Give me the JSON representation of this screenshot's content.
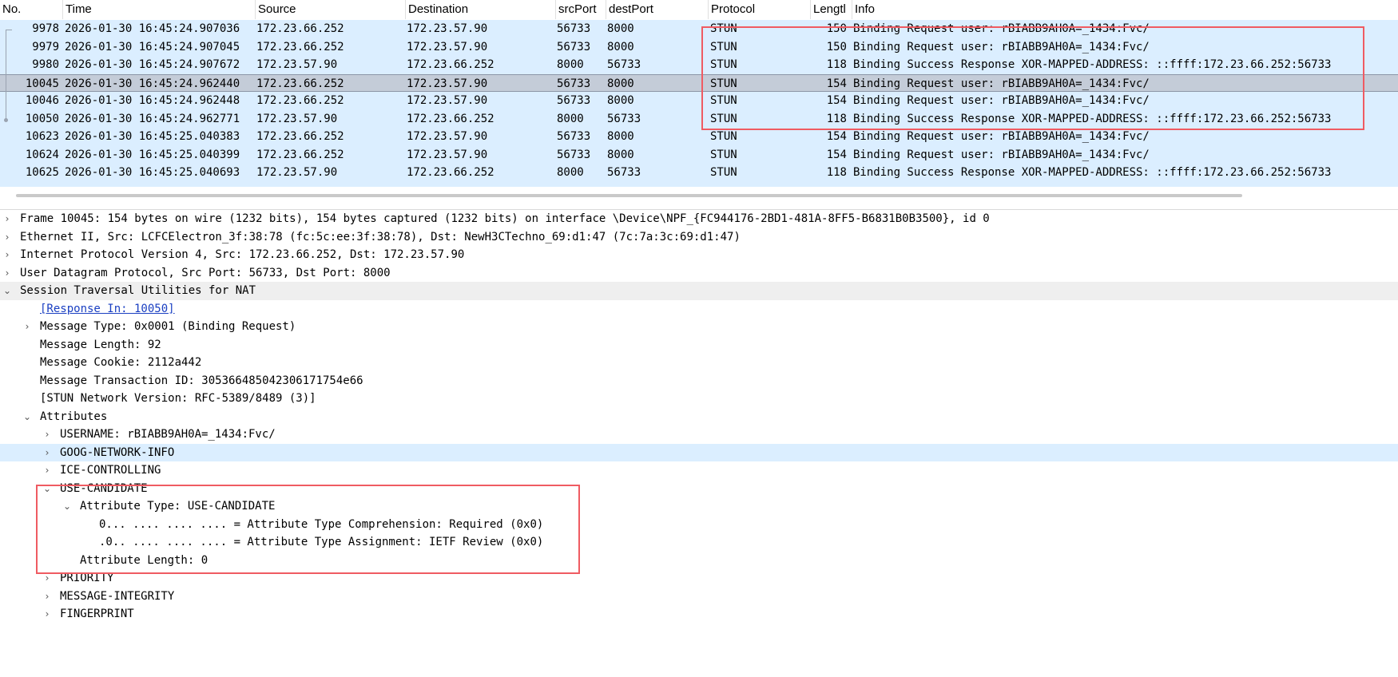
{
  "columns": [
    "No.",
    "Time",
    "Source",
    "Destination",
    "srcPort",
    "destPort",
    "Protocol",
    "Lengtl",
    "Info"
  ],
  "packets": [
    {
      "no": "9978",
      "time": "2026-01-30 16:45:24.907036",
      "src": "172.23.66.252",
      "dst": "172.23.57.90",
      "sport": "56733",
      "dport": "8000",
      "proto": "STUN",
      "len": "150",
      "info": "Binding Request user: rBIABB9AH0A=_1434:Fvc/"
    },
    {
      "no": "9979",
      "time": "2026-01-30 16:45:24.907045",
      "src": "172.23.66.252",
      "dst": "172.23.57.90",
      "sport": "56733",
      "dport": "8000",
      "proto": "STUN",
      "len": "150",
      "info": "Binding Request user: rBIABB9AH0A=_1434:Fvc/"
    },
    {
      "no": "9980",
      "time": "2026-01-30 16:45:24.907672",
      "src": "172.23.57.90",
      "dst": "172.23.66.252",
      "sport": "8000",
      "dport": "56733",
      "proto": "STUN",
      "len": "118",
      "info": "Binding Success Response XOR-MAPPED-ADDRESS: ::ffff:172.23.66.252:56733"
    },
    {
      "no": "10045",
      "time": "2026-01-30 16:45:24.962440",
      "src": "172.23.66.252",
      "dst": "172.23.57.90",
      "sport": "56733",
      "dport": "8000",
      "proto": "STUN",
      "len": "154",
      "info": "Binding Request user: rBIABB9AH0A=_1434:Fvc/"
    },
    {
      "no": "10046",
      "time": "2026-01-30 16:45:24.962448",
      "src": "172.23.66.252",
      "dst": "172.23.57.90",
      "sport": "56733",
      "dport": "8000",
      "proto": "STUN",
      "len": "154",
      "info": "Binding Request user: rBIABB9AH0A=_1434:Fvc/"
    },
    {
      "no": "10050",
      "time": "2026-01-30 16:45:24.962771",
      "src": "172.23.57.90",
      "dst": "172.23.66.252",
      "sport": "8000",
      "dport": "56733",
      "proto": "STUN",
      "len": "118",
      "info": "Binding Success Response XOR-MAPPED-ADDRESS: ::ffff:172.23.66.252:56733"
    },
    {
      "no": "10623",
      "time": "2026-01-30 16:45:25.040383",
      "src": "172.23.66.252",
      "dst": "172.23.57.90",
      "sport": "56733",
      "dport": "8000",
      "proto": "STUN",
      "len": "154",
      "info": "Binding Request user: rBIABB9AH0A=_1434:Fvc/"
    },
    {
      "no": "10624",
      "time": "2026-01-30 16:45:25.040399",
      "src": "172.23.66.252",
      "dst": "172.23.57.90",
      "sport": "56733",
      "dport": "8000",
      "proto": "STUN",
      "len": "154",
      "info": "Binding Request user: rBIABB9AH0A=_1434:Fvc/"
    },
    {
      "no": "10625",
      "time": "2026-01-30 16:45:25.040693",
      "src": "172.23.57.90",
      "dst": "172.23.66.252",
      "sport": "8000",
      "dport": "56733",
      "proto": "STUN",
      "len": "118",
      "info": "Binding Success Response XOR-MAPPED-ADDRESS: ::ffff:172.23.66.252:56733"
    }
  ],
  "details": {
    "frame": "Frame 10045: 154 bytes on wire (1232 bits), 154 bytes captured (1232 bits) on interface \\Device\\NPF_{FC944176-2BD1-481A-8FF5-B6831B0B3500}, id 0",
    "ethernet": "Ethernet II, Src: LCFCElectron_3f:38:78 (fc:5c:ee:3f:38:78), Dst: NewH3CTechno_69:d1:47 (7c:7a:3c:69:d1:47)",
    "ip": "Internet Protocol Version 4, Src: 172.23.66.252, Dst: 172.23.57.90",
    "udp": "User Datagram Protocol, Src Port: 56733, Dst Port: 8000",
    "stun": "Session Traversal Utilities for NAT",
    "response_in": "[Response In: 10050]",
    "msg_type": "Message Type: 0x0001 (Binding Request)",
    "msg_len": "Message Length: 92",
    "cookie": "Message Cookie: 2112a442",
    "txid": "Message Transaction ID: 305366485042306171754e66",
    "version": "[STUN Network Version: RFC-5389/8489 (3)]",
    "attributes": "Attributes",
    "username": "USERNAME: rBIABB9AH0A=_1434:Fvc/",
    "goog": "GOOG-NETWORK-INFO",
    "ice": "ICE-CONTROLLING",
    "use_candidate": "USE-CANDIDATE",
    "attr_type": "Attribute Type: USE-CANDIDATE",
    "comprehension": "0... .... .... .... = Attribute Type Comprehension: Required (0x0)",
    "assignment": ".0.. .... .... .... = Attribute Type Assignment: IETF Review (0x0)",
    "attr_len": "Attribute Length: 0",
    "priority": "PRIORITY",
    "integrity": "MESSAGE-INTEGRITY",
    "fingerprint": "FINGERPRINT"
  },
  "colors": {
    "row_bg": "#dbeeff",
    "selected_bg": "#c4ccd8",
    "highlight_box": "#ef5b62",
    "link": "#1a3fc2"
  }
}
